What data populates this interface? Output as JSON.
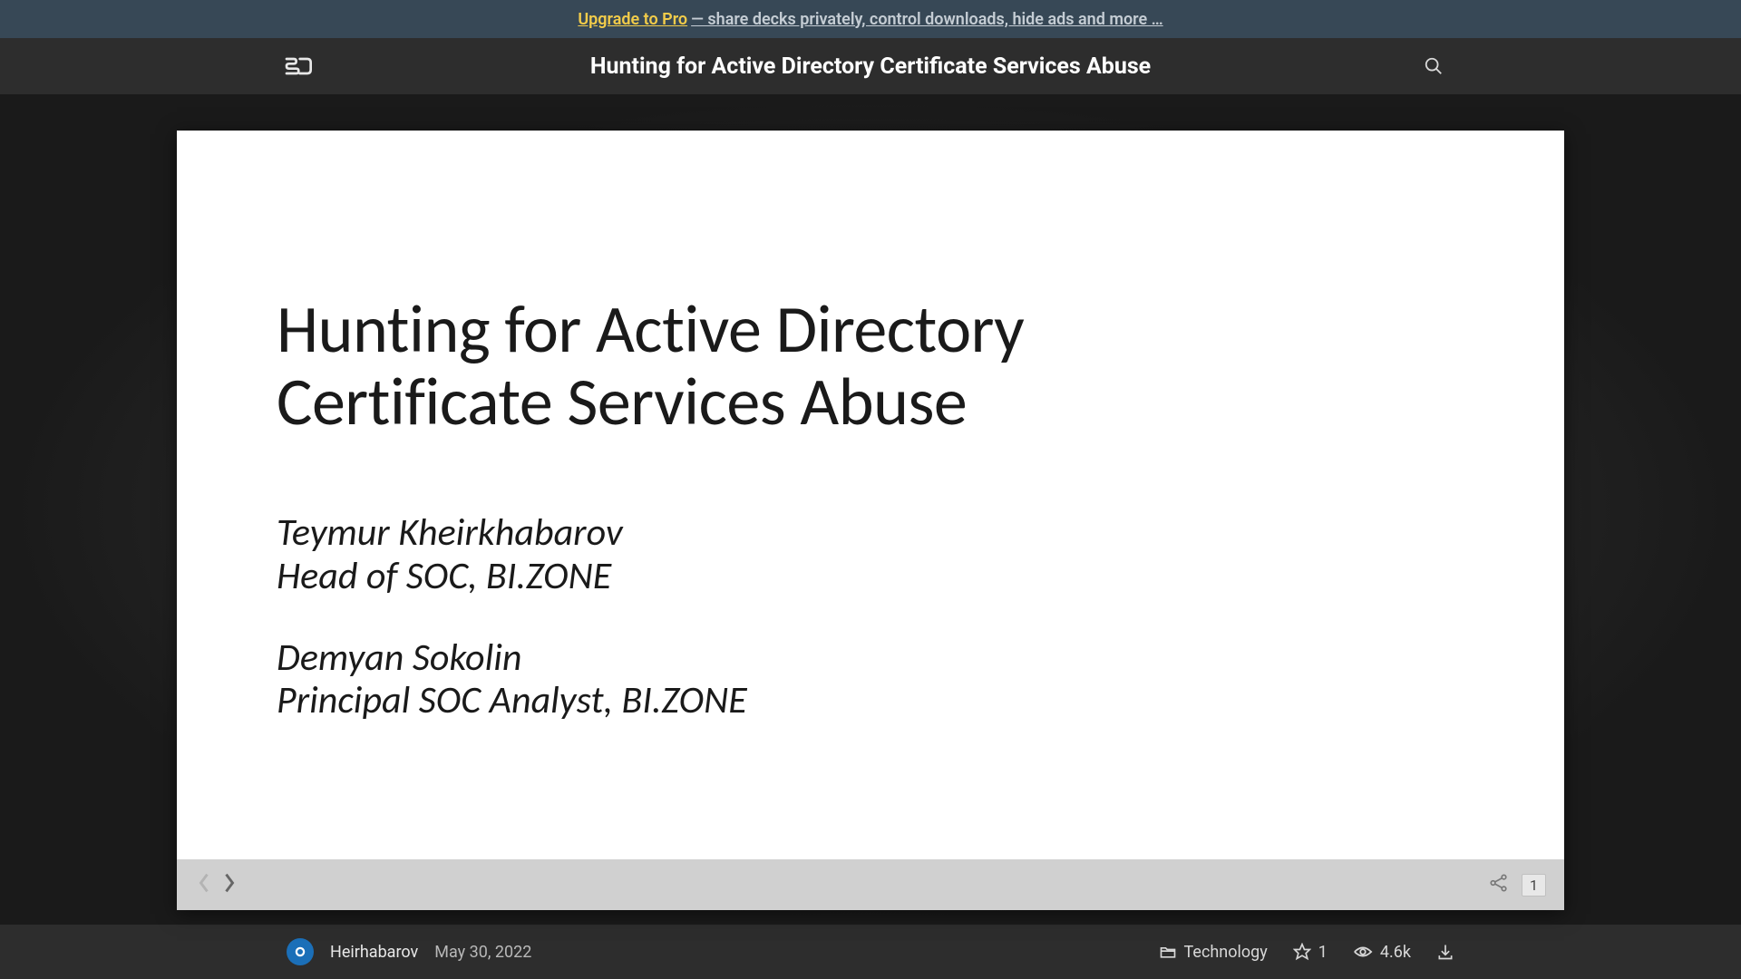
{
  "promo": {
    "link_text": "Upgrade to Pro",
    "description": "— share decks privately, control downloads, hide ads and more …"
  },
  "header": {
    "title": "Hunting for Active Directory Certificate Services Abuse"
  },
  "slide": {
    "title_line1": "Hunting for Active Directory",
    "title_line2": "Certificate Services Abuse",
    "author1_name": "Teymur Kheirkhabarov",
    "author1_role": "Head of SOC, BI.ZONE",
    "author2_name": "Demyan Sokolin",
    "author2_role": "Principal SOC Analyst, BI.ZONE",
    "current_page": "1"
  },
  "footer": {
    "author": "Heirhabarov",
    "date": "May 30, 2022",
    "category": "Technology",
    "stars": "1",
    "views": "4.6k"
  }
}
